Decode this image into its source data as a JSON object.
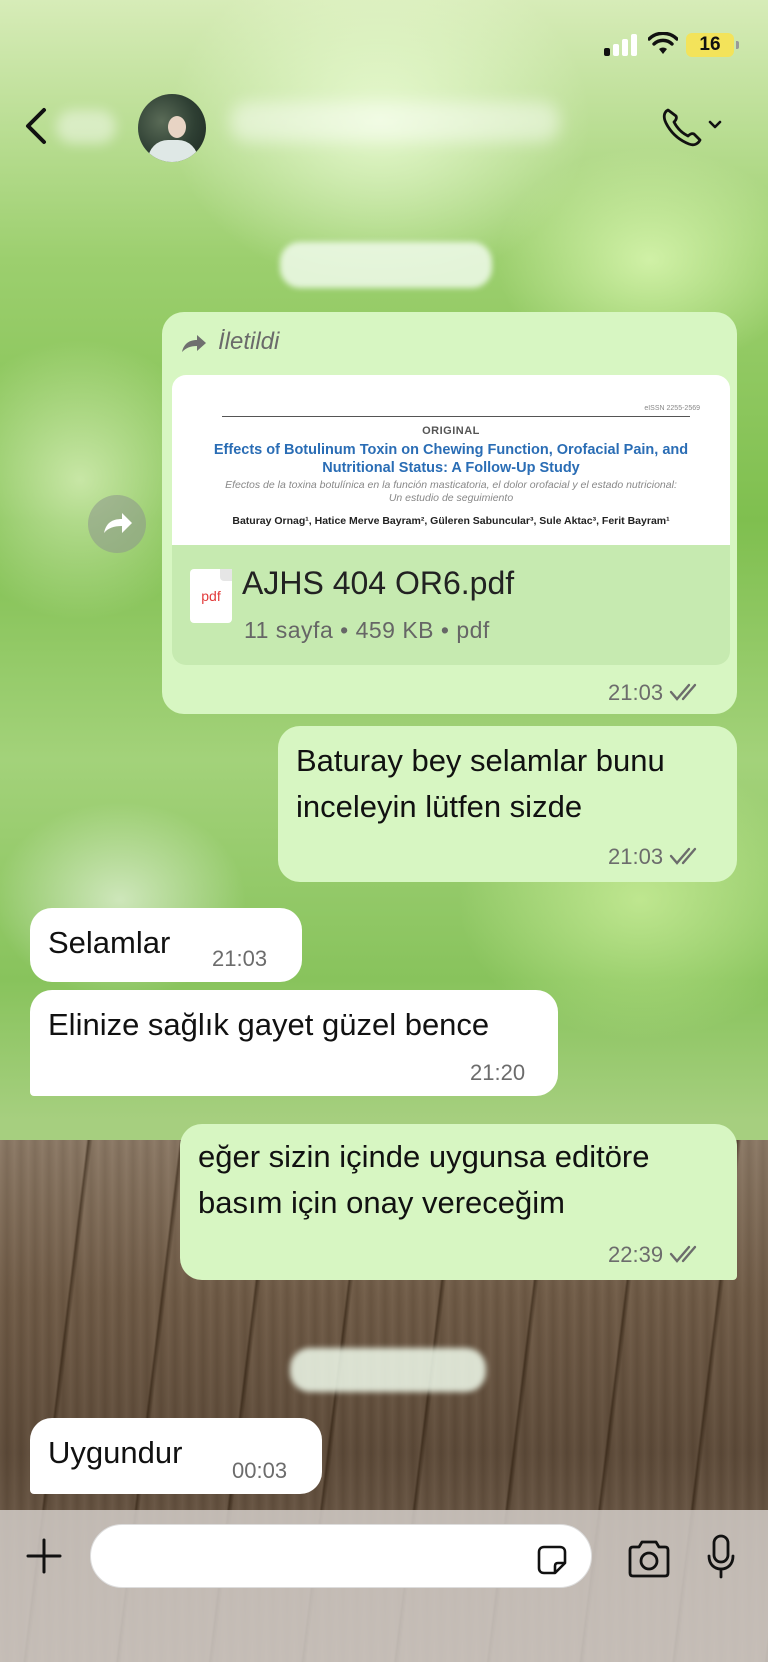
{
  "status_bar": {
    "battery": "16"
  },
  "messages": {
    "forwarded_label": "İletildi",
    "document": {
      "preview": {
        "issn": "eISSN 2255-2569",
        "kind": "ORIGINAL",
        "title": "Effects of Botulinum Toxin on Chewing Function, Orofacial Pain, and Nutritional Status: A Follow-Up Study",
        "subtitle": "Efectos de la toxina botulínica en la función masticatoria, el dolor orofacial y el estado nutricional: Un estudio de seguimiento",
        "authors": "Baturay Ornag¹, Hatice Merve Bayram², Güleren Sabuncular³, Sule Aktac³, Ferit Bayram¹"
      },
      "file_icon": "pdf",
      "file_name": "AJHS 404 OR6.pdf",
      "file_meta": "11 sayfa • 459 KB • pdf",
      "time": "21:03"
    },
    "out1": {
      "text": "Baturay bey selamlar bunu inceleyin lütfen sizde",
      "time": "21:03"
    },
    "in1": {
      "text": "Selamlar",
      "time": "21:03"
    },
    "in2": {
      "text": "Elinize sağlık gayet güzel bence",
      "time": "21:20"
    },
    "out2": {
      "text": "eğer sizin içinde uygunsa editöre basım için onay vereceğim",
      "time": "22:39"
    },
    "in3": {
      "text": "Uygundur",
      "time": "00:03"
    }
  },
  "icons": [
    "back-chevron-icon",
    "call-icon",
    "forward-icon",
    "pdf-icon",
    "read-ticks-icon",
    "plus-icon",
    "sticker-icon",
    "camera-icon",
    "mic-icon"
  ],
  "colors": {
    "outgoing_bubble": "#d7f6c2",
    "incoming_bubble": "#ffffff",
    "battery": "#f3e35a",
    "pdf_red": "#e23b3b"
  }
}
